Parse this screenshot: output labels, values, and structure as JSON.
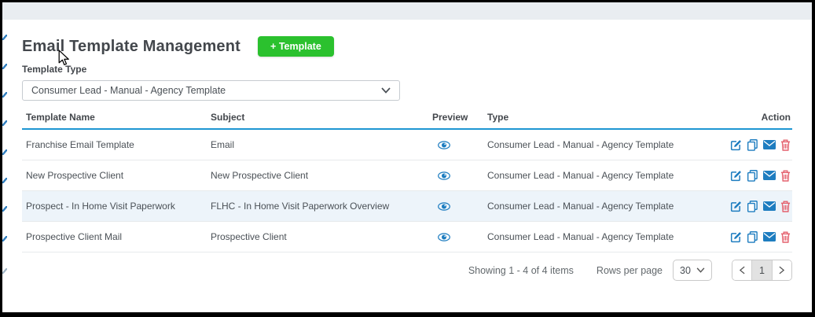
{
  "page": {
    "title": "Email Template Management",
    "add_button_label": "+ Template"
  },
  "filter": {
    "label": "Template Type",
    "selected_value": "Consumer Lead - Manual - Agency Template"
  },
  "table": {
    "columns": [
      "Template Name",
      "Subject",
      "Preview",
      "Type",
      "Action"
    ],
    "rows": [
      {
        "name": "Franchise Email Template",
        "subject": "Email",
        "type": "Consumer Lead - Manual - Agency Template"
      },
      {
        "name": "New Prospective Client",
        "subject": "New Prospective Client",
        "type": "Consumer Lead - Manual - Agency Template"
      },
      {
        "name": "Prospect - In Home Visit Paperwork",
        "subject": "FLHC - In Home Visit Paperwork Overview",
        "type": "Consumer Lead - Manual - Agency Template"
      },
      {
        "name": "Prospective Client Mail",
        "subject": "Prospective Client",
        "type": "Consumer Lead - Manual - Agency Template"
      }
    ],
    "preview_icon": "eye-icon",
    "action_icons": [
      "edit-icon",
      "copy-icon",
      "mail-icon",
      "delete-icon"
    ]
  },
  "footer": {
    "showing_text": "Showing 1 - 4 of 4 items",
    "rows_per_page_label": "Rows per page",
    "rows_per_page_value": "30",
    "pager": {
      "current_page": "1"
    }
  },
  "colors": {
    "accent_green": "#2bc12e",
    "icon_blue": "#1e7dc0",
    "header_underline_blue": "#1e96d2",
    "delete_red": "#e4606d",
    "row_highlight": "#edf4fa",
    "topbar_gray": "#e9edf1"
  }
}
